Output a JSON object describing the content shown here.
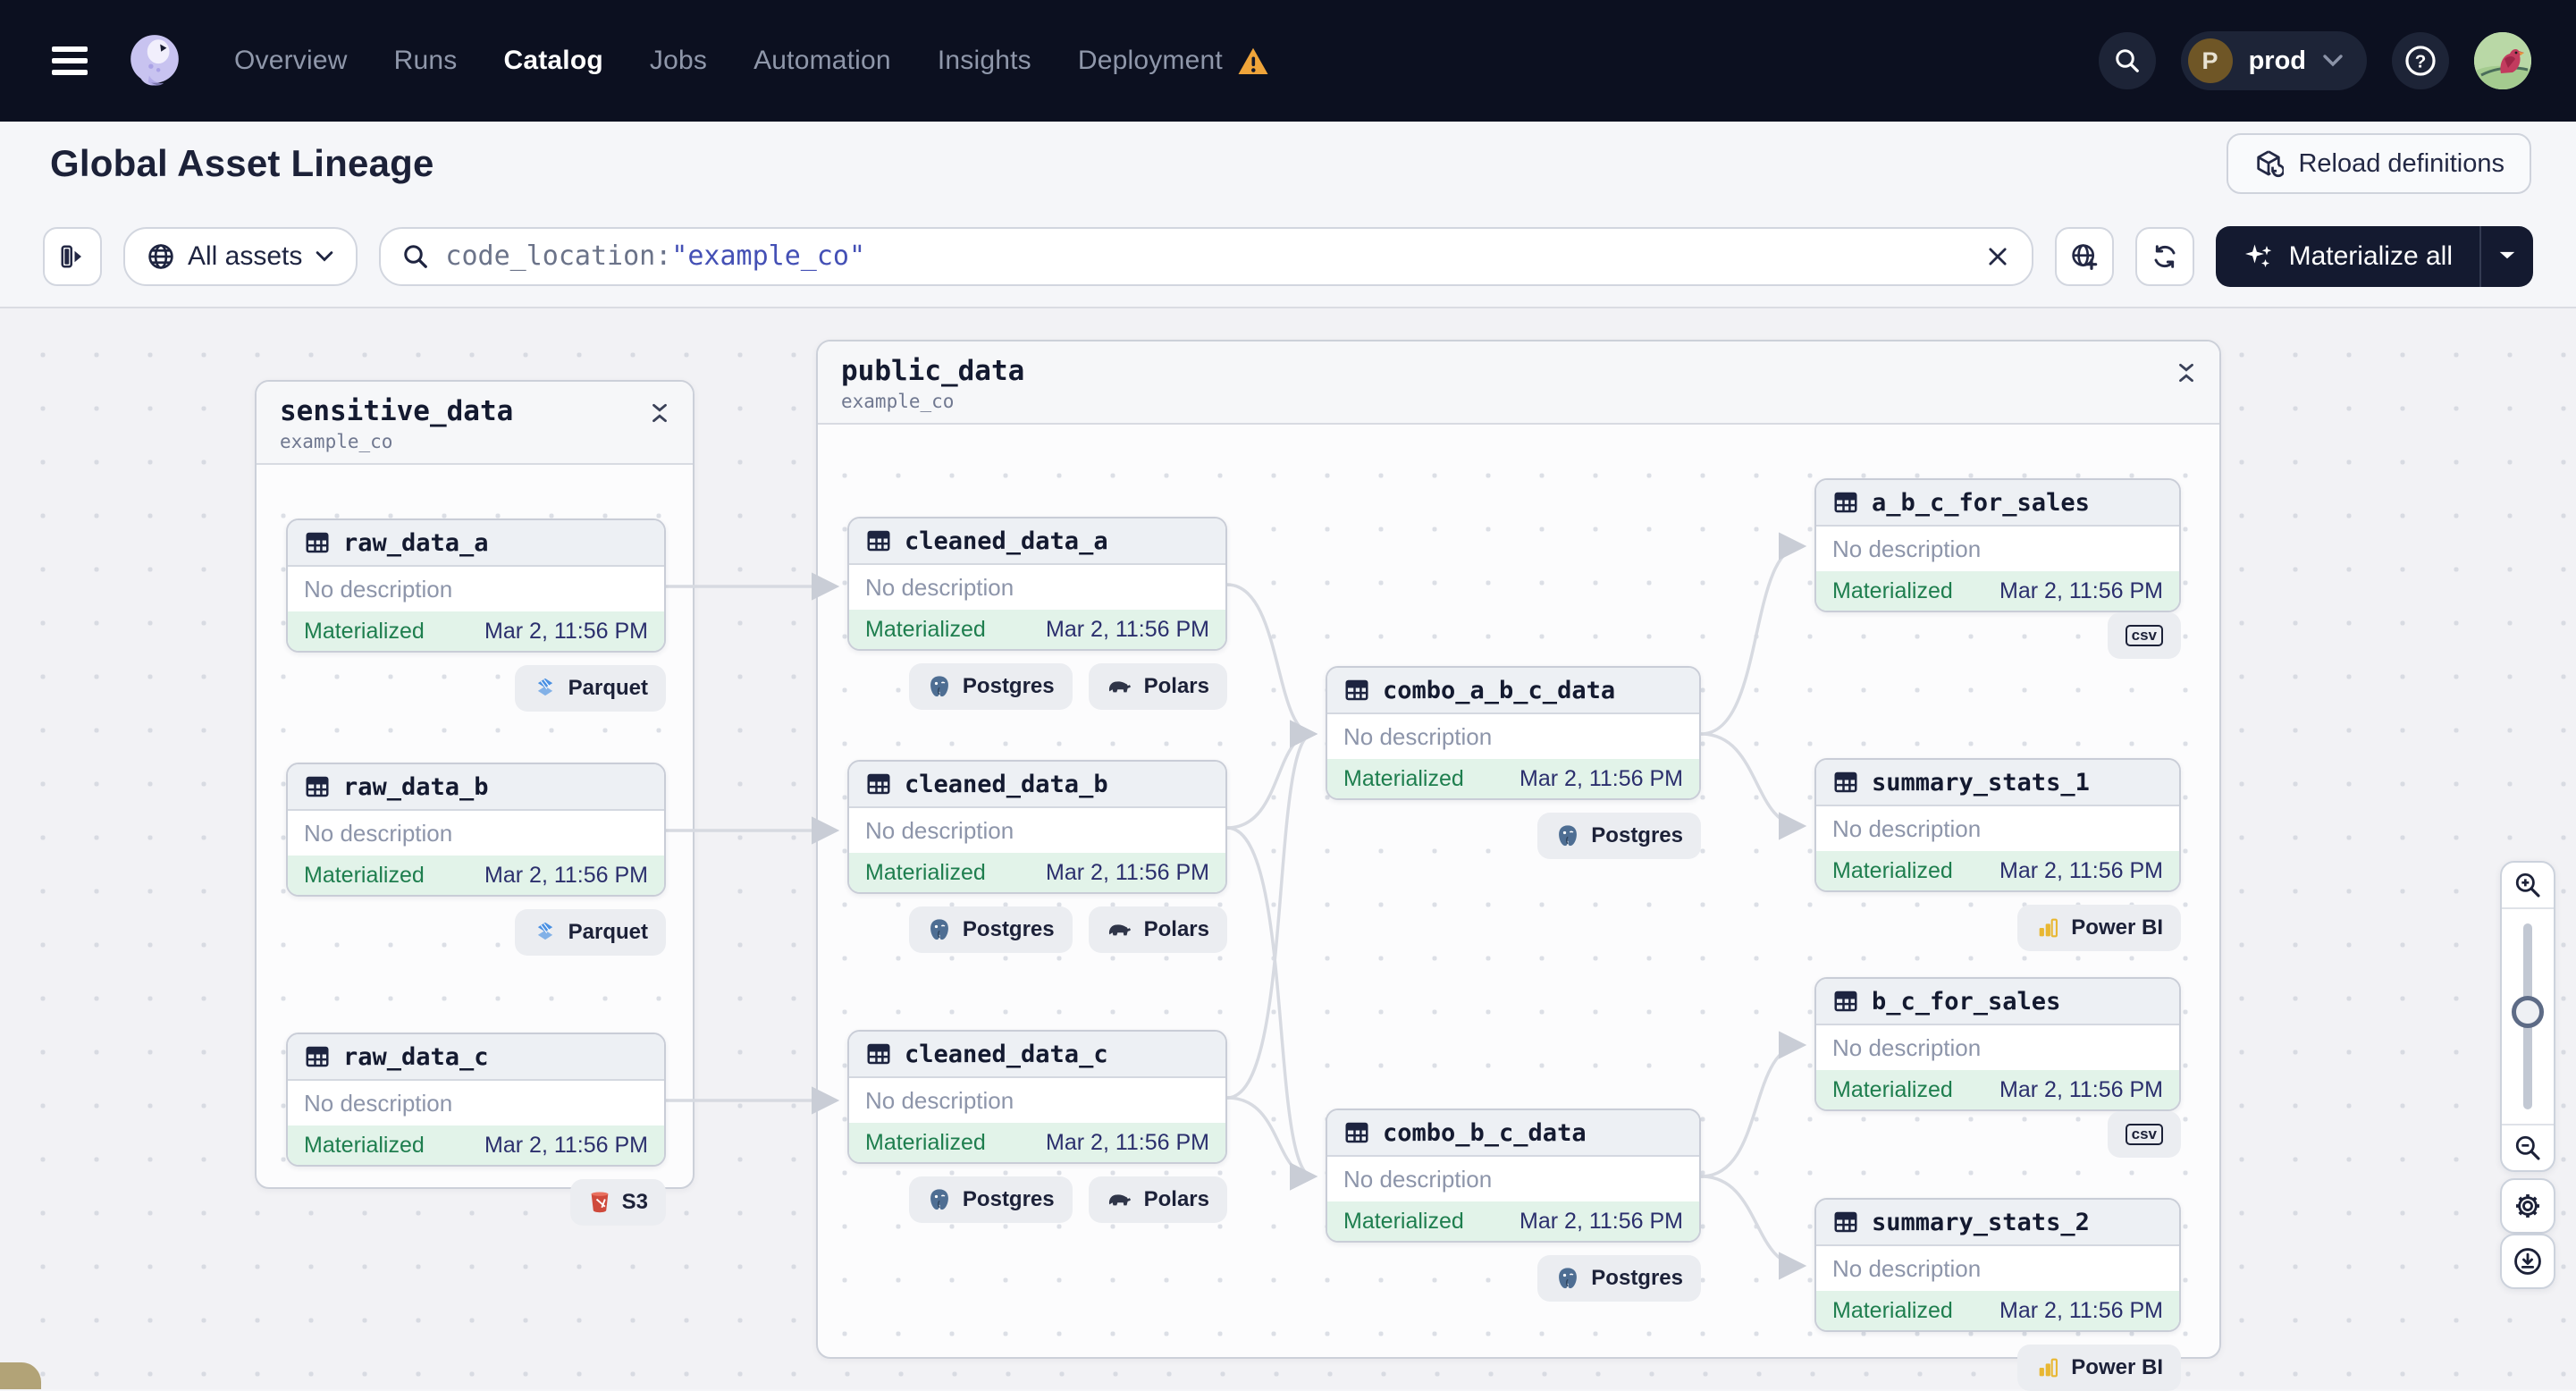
{
  "nav": {
    "brand": "Dagster",
    "items": [
      {
        "label": "Overview"
      },
      {
        "label": "Runs"
      },
      {
        "label": "Catalog"
      },
      {
        "label": "Jobs"
      },
      {
        "label": "Automation"
      },
      {
        "label": "Insights"
      },
      {
        "label": "Deployment"
      }
    ],
    "active_item": "Catalog",
    "deployment_switcher": {
      "initial": "P",
      "name": "prod"
    }
  },
  "header": {
    "title": "Global Asset Lineage",
    "reload_button_label": "Reload definitions"
  },
  "toolbar": {
    "filter_label": "All assets",
    "search_text_plain": "code_location:",
    "search_text_value": "\"example_co\"",
    "materialize_button_label": "Materialize all"
  },
  "colors": {
    "nav_background": "#0c1020",
    "status_green": "#1e7e4e",
    "timestamp_indigo": "#2b2f6d",
    "warning_orange": "#efa43a",
    "search_value_blue": "#4450b5"
  },
  "graph": {
    "groups": [
      {
        "name": "sensitive_data",
        "location": "example_co"
      },
      {
        "name": "public_data",
        "location": "example_co"
      }
    ],
    "nodes": [
      {
        "name": "raw_data_a",
        "description": "No description",
        "status": "Materialized",
        "timestamp": "Mar 2, 11:56 PM",
        "tags": [
          {
            "label": "Parquet",
            "icon": "parquet-icon"
          }
        ]
      },
      {
        "name": "raw_data_b",
        "description": "No description",
        "status": "Materialized",
        "timestamp": "Mar 2, 11:56 PM",
        "tags": [
          {
            "label": "Parquet",
            "icon": "parquet-icon"
          }
        ]
      },
      {
        "name": "raw_data_c",
        "description": "No description",
        "status": "Materialized",
        "timestamp": "Mar 2, 11:56 PM",
        "tags": [
          {
            "label": "S3",
            "icon": "s3-icon"
          }
        ]
      },
      {
        "name": "cleaned_data_a",
        "description": "No description",
        "status": "Materialized",
        "timestamp": "Mar 2, 11:56 PM",
        "tags": [
          {
            "label": "Postgres",
            "icon": "postgres-icon"
          },
          {
            "label": "Polars",
            "icon": "polars-icon"
          }
        ]
      },
      {
        "name": "cleaned_data_b",
        "description": "No description",
        "status": "Materialized",
        "timestamp": "Mar 2, 11:56 PM",
        "tags": [
          {
            "label": "Postgres",
            "icon": "postgres-icon"
          },
          {
            "label": "Polars",
            "icon": "polars-icon"
          }
        ]
      },
      {
        "name": "cleaned_data_c",
        "description": "No description",
        "status": "Materialized",
        "timestamp": "Mar 2, 11:56 PM",
        "tags": [
          {
            "label": "Postgres",
            "icon": "postgres-icon"
          },
          {
            "label": "Polars",
            "icon": "polars-icon"
          }
        ]
      },
      {
        "name": "combo_a_b_c_data",
        "description": "No description",
        "status": "Materialized",
        "timestamp": "Mar 2, 11:56 PM",
        "tags": [
          {
            "label": "Postgres",
            "icon": "postgres-icon"
          }
        ]
      },
      {
        "name": "combo_b_c_data",
        "description": "No description",
        "status": "Materialized",
        "timestamp": "Mar 2, 11:56 PM",
        "tags": [
          {
            "label": "Postgres",
            "icon": "postgres-icon"
          }
        ]
      },
      {
        "name": "a_b_c_for_sales",
        "description": "No description",
        "status": "Materialized",
        "timestamp": "Mar 2, 11:56 PM",
        "tags": [
          {
            "label": "csv",
            "icon": "csv-icon"
          }
        ]
      },
      {
        "name": "summary_stats_1",
        "description": "No description",
        "status": "Materialized",
        "timestamp": "Mar 2, 11:56 PM",
        "tags": [
          {
            "label": "Power BI",
            "icon": "powerbi-icon"
          }
        ]
      },
      {
        "name": "b_c_for_sales",
        "description": "No description",
        "status": "Materialized",
        "timestamp": "Mar 2, 11:56 PM",
        "tags": [
          {
            "label": "csv",
            "icon": "csv-icon"
          }
        ]
      },
      {
        "name": "summary_stats_2",
        "description": "No description",
        "status": "Materialized",
        "timestamp": "Mar 2, 11:56 PM",
        "tags": [
          {
            "label": "Power BI",
            "icon": "powerbi-icon"
          }
        ]
      }
    ]
  }
}
